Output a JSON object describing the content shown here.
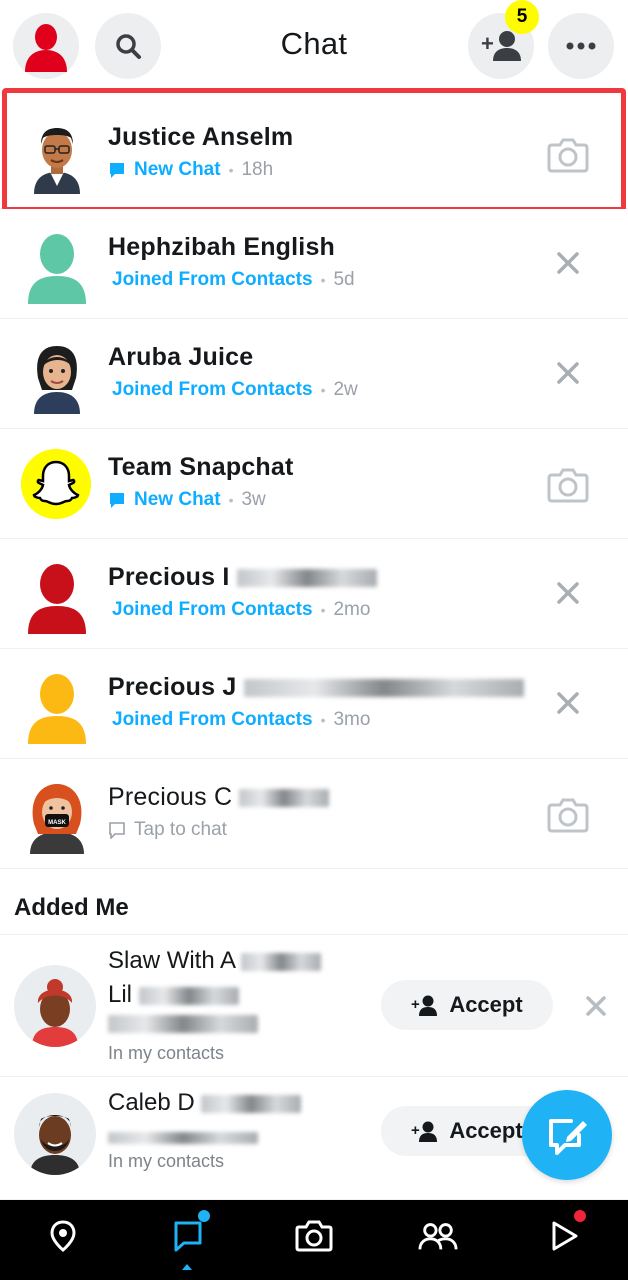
{
  "header": {
    "title": "Chat",
    "friend_request_count": "5",
    "colors": {
      "badge": "#fffc00",
      "accent_blue": "#0fadff",
      "highlight_red": "#f0393e"
    }
  },
  "chats": [
    {
      "name": "Justice Anselm",
      "status": "New Chat",
      "time": "18h",
      "status_type": "new-chat",
      "action": "camera-icon"
    },
    {
      "name": "Hephzibah English",
      "status": "Joined From Contacts",
      "time": "5d",
      "status_type": "joined",
      "action": "close-icon"
    },
    {
      "name": "Aruba Juice",
      "status": "Joined From Contacts",
      "time": "2w",
      "status_type": "joined",
      "action": "close-icon"
    },
    {
      "name": "Team Snapchat",
      "status": "New Chat",
      "time": "3w",
      "status_type": "new-chat",
      "action": "camera-icon"
    },
    {
      "name": "Precious I",
      "status": "Joined From Contacts",
      "time": "2mo",
      "status_type": "joined",
      "action": "close-icon"
    },
    {
      "name": "Precious J",
      "status": "Joined From Contacts",
      "time": "3mo",
      "status_type": "joined",
      "action": "close-icon"
    },
    {
      "name": "Precious C",
      "status": "Tap to chat",
      "time": "",
      "status_type": "tap",
      "action": "camera-icon"
    }
  ],
  "added_me": {
    "title": "Added Me",
    "items": [
      {
        "name": "Slaw With A",
        "line2": "Lil",
        "meta": "In my contacts",
        "accept_label": "Accept"
      },
      {
        "name": "Caleb D",
        "meta": "In my contacts",
        "accept_label": "Accept"
      }
    ]
  },
  "bottom_nav": {
    "items": [
      "map-pin-icon",
      "chat-icon",
      "camera-icon",
      "friends-icon",
      "stories-play-icon"
    ],
    "active": "chat-icon"
  }
}
